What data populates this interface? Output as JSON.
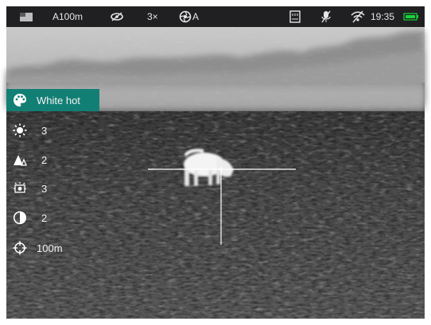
{
  "status": {
    "mode_icon": "display-mode-icon",
    "range": "A100m",
    "stealth_icon": "eye-slash-icon",
    "zoom": "3×",
    "calibration": "A",
    "calibration_icon": "shutter-icon",
    "record_icon": "sd-card-icon",
    "mic_icon": "mic-off-icon",
    "wifi_icon": "wifi-off-icon",
    "time": "19:35",
    "battery_color": "#17d23a"
  },
  "menu": {
    "items": [
      {
        "icon": "palette-icon",
        "value": "White hot",
        "selected": true
      },
      {
        "icon": "brightness-icon",
        "value": "3"
      },
      {
        "icon": "sharpness-icon",
        "value": "2"
      },
      {
        "icon": "smoothing-icon",
        "value": "3"
      },
      {
        "icon": "contrast-icon",
        "value": "2"
      },
      {
        "icon": "reticle-icon",
        "value": "100m"
      }
    ],
    "accent_color": "#127f75"
  },
  "reticle": {
    "type": "crosshair"
  }
}
